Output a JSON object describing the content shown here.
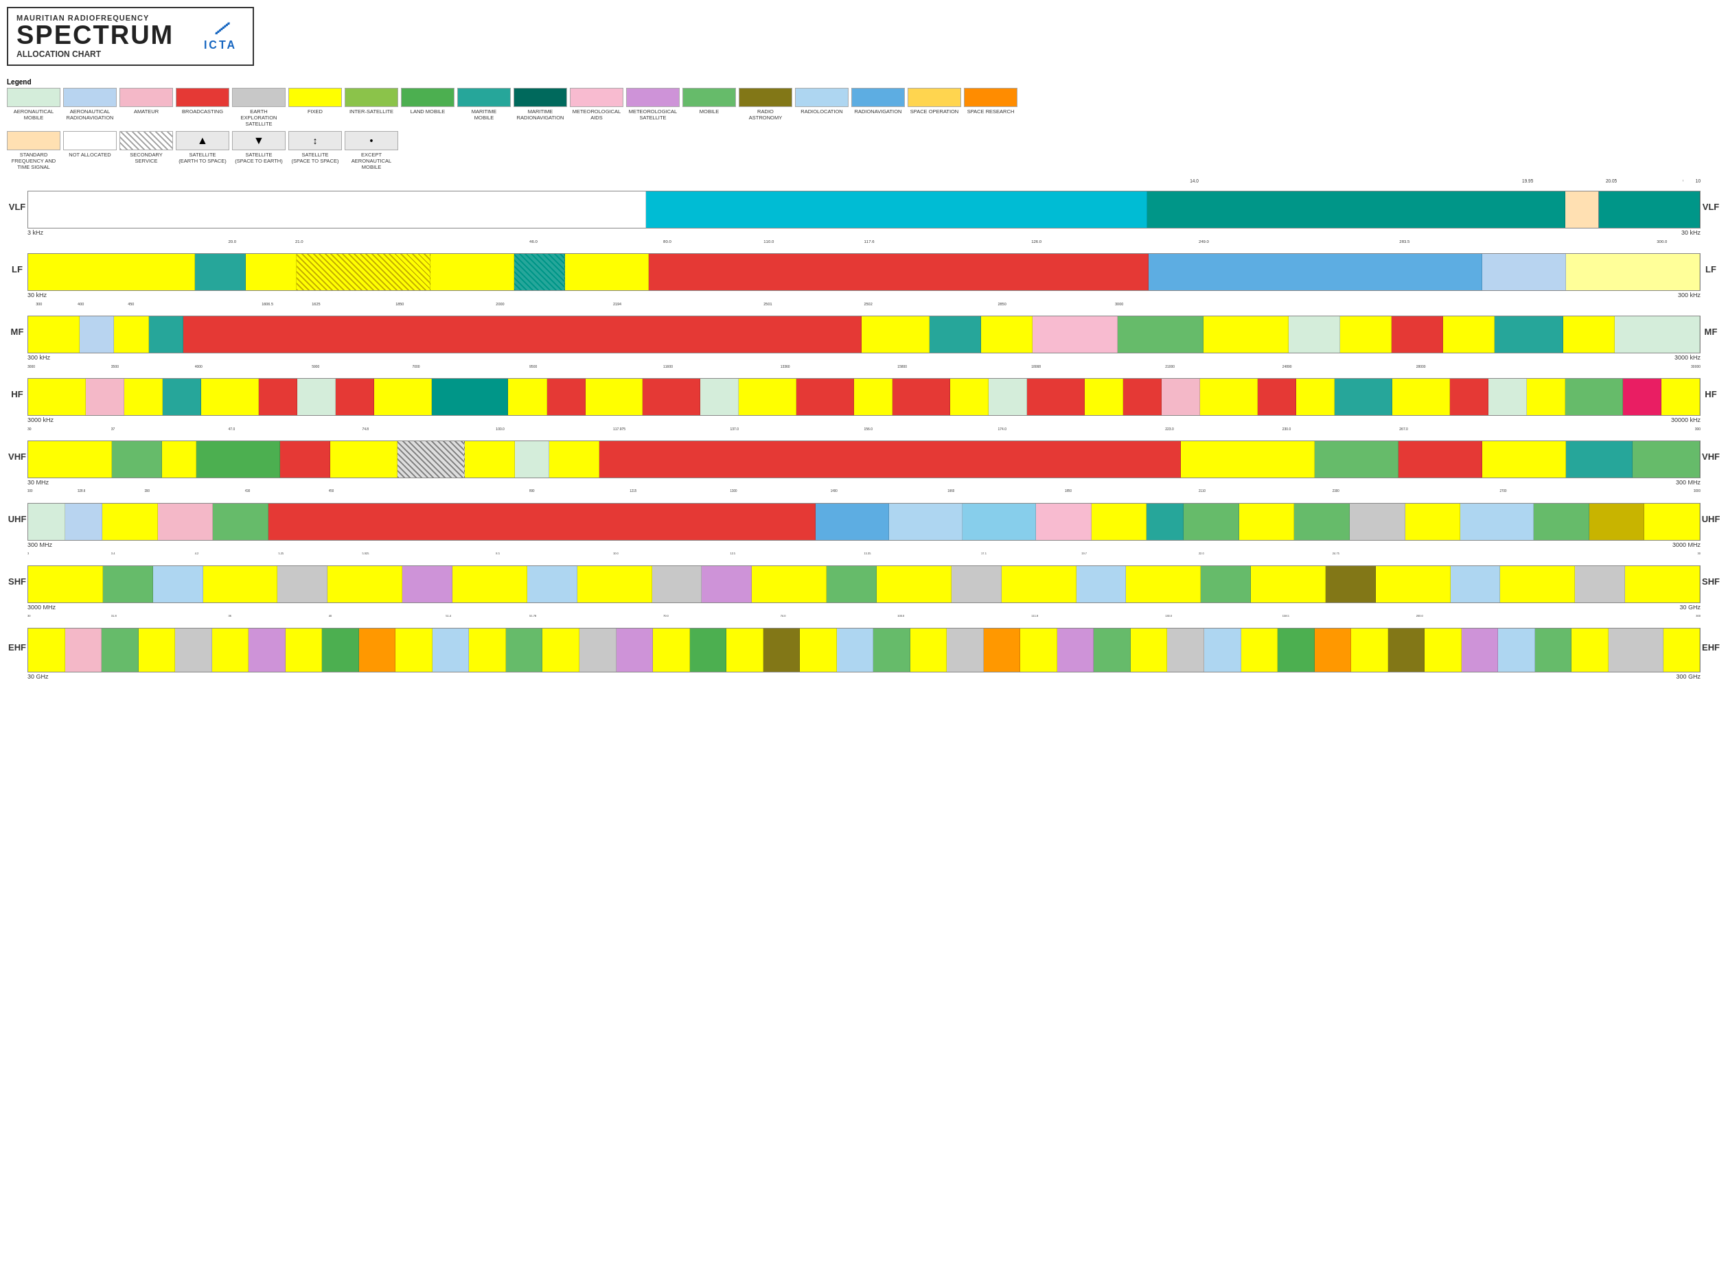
{
  "header": {
    "subtitle": "MAURITIAN RADIOFREQUENCY",
    "title": "SPECTRUM",
    "alloc": "ALLOCATION CHART",
    "logo_symbol": "⟋",
    "logo_text": "ICTA"
  },
  "legend": {
    "label": "Legend",
    "colors": [
      {
        "color": "#d4edda",
        "label": "AERONAUTICAL\nMOBILE"
      },
      {
        "color": "#b8d4f0",
        "label": "AERONAUTICAL\nRADIONAVIGATION"
      },
      {
        "color": "#f4b8c8",
        "label": "AMATEUR"
      },
      {
        "color": "#e53935",
        "label": "BROADCASTING"
      },
      {
        "color": "#c8c8c8",
        "label": "EARTH\nEXPLORATION\nSATELLITE"
      },
      {
        "color": "#ffff00",
        "label": "FIXED"
      },
      {
        "color": "#8bc34a",
        "label": "INTER-SATELLITE"
      },
      {
        "color": "#4caf50",
        "label": "LAND MOBILE"
      },
      {
        "color": "#26a69a",
        "label": "MARITIME\nMOBILE"
      },
      {
        "color": "#00695c",
        "label": "MARITIME\nRADIONAVIGATION"
      },
      {
        "color": "#f8bbd0",
        "label": "METEOROLOGICAL\nAIDS"
      },
      {
        "color": "#ce93d8",
        "label": "METEOROLOGICAL\nSATELLITE"
      },
      {
        "color": "#66bb6a",
        "label": "MOBILE"
      },
      {
        "color": "#827717",
        "label": "RADIO\nASTRONOMY"
      },
      {
        "color": "#aed6f1",
        "label": "RADIOLOCATION"
      },
      {
        "color": "#5dade2",
        "label": "RADIONAVIGATION"
      },
      {
        "color": "#ffd54f",
        "label": "SPACE OPERATION"
      },
      {
        "color": "#ff8c00",
        "label": "SPACE RESEARCH"
      }
    ],
    "patterns": [
      {
        "type": "plain-light",
        "label": "STANDARD\nFREQUENCY AND\nTIME SIGNAL"
      },
      {
        "type": "plain-white",
        "label": "NOT ALLOCATED"
      },
      {
        "type": "hatch",
        "label": "SECONDARY\nSERVICE"
      },
      {
        "type": "sat-up",
        "label": "SATELLITE\n(EARTH TO SPACE)"
      },
      {
        "type": "sat-down",
        "label": "SATELLITE\n(SPACE TO EARTH)"
      },
      {
        "type": "sat-both",
        "label": "SATELLITE\n(SPACE TO SPACE)"
      },
      {
        "type": "except",
        "label": "EXCEPT\nAERONAUTICAL\nMOBILE"
      }
    ]
  },
  "bands": {
    "vlf": {
      "label": "VLF",
      "range_start": "3 kHz",
      "range_end": "30 kHz"
    },
    "lf": {
      "label": "LF",
      "range_start": "30 kHz",
      "range_end": "300 kHz"
    },
    "mf": {
      "label": "MF",
      "range_start": "300 kHz",
      "range_end": "3000 kHz"
    },
    "hf": {
      "label": "HF",
      "range_start": "3000 kHz",
      "range_end": "30000 kHz"
    },
    "vhf": {
      "label": "VHF",
      "range_start": "30 MHz",
      "range_end": "300 MHz"
    },
    "uhf": {
      "label": "UHF",
      "range_start": "300 MHz",
      "range_end": "3000 MHz"
    },
    "shf": {
      "label": "SHF",
      "range_start": "3000 MHz",
      "range_end": "30 GHz"
    },
    "ehf": {
      "label": "EHF",
      "range_start": "30 GHz",
      "range_end": "300 GHz"
    }
  }
}
